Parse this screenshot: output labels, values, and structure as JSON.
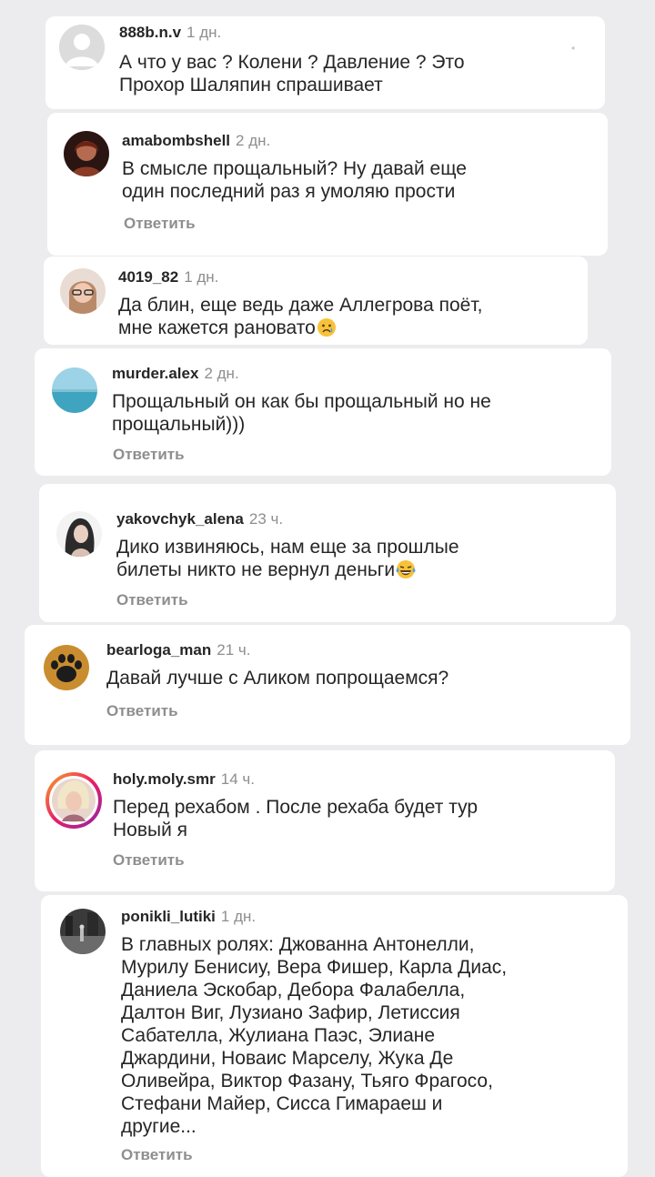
{
  "comments": [
    {
      "username": "888b.n.v",
      "time": "1 дн.",
      "text": "А что у вас ? Колени ? Давление ? Это\nПрохор Шаляпин спрашивает",
      "avatar_icon": "default-user-icon"
    },
    {
      "username": "amabombshell",
      "time": "2 дн.",
      "text": "В смысле прощальный? Ну давай еще\nодин последний раз я умоляю прости",
      "reply": "Ответить"
    },
    {
      "username": "4019_82",
      "time": "1 дн.",
      "text": "Да блин, еще ведь даже Аллегрова поёт,\nмне кажется рановато",
      "emoji": "crying-face-emoji"
    },
    {
      "username": "murder.alex",
      "time": "2 дн.",
      "text": "Прощальный он как бы прощальный но не\nпрощальный)))",
      "reply": "Ответить"
    },
    {
      "username": "yakovchyk_alena",
      "time": "23 ч.",
      "text": "Дико извиняюсь, нам еще за прошлые\nбилеты никто не вернул деньги",
      "emoji": "tears-of-joy-emoji",
      "reply": "Ответить"
    },
    {
      "username": "bearloga_man",
      "time": "21 ч.",
      "text": "Давай лучше с Аликом попрощаемся?",
      "reply": "Ответить",
      "avatar_icon": "paw-icon"
    },
    {
      "username": "holy.moly.smr",
      "time": "14 ч.",
      "text": "Перед рехабом . После рехаба будет тур\nНовый я",
      "reply": "Ответить"
    },
    {
      "username": "ponikli_lutiki",
      "time": "1 дн.",
      "text": "В главных ролях: Джованна Антонелли,\nМурилу Бенисиу, Вера Фишер, Карла Диас,\nДаниела Эскобар, Дебора Фалабелла,\nДалтон Виг, Лузиано Зафир, Летиссия\nСабателла, Жулиана Паэс, Элиане\nДжардини, Новаис Марселу, Жука Де\nОливейра, Виктор Фазану, Тьяго Фрагосо,\nСтефани Майер, Сисса Гимараеш и\nдругие...",
      "reply": "Ответить"
    }
  ]
}
